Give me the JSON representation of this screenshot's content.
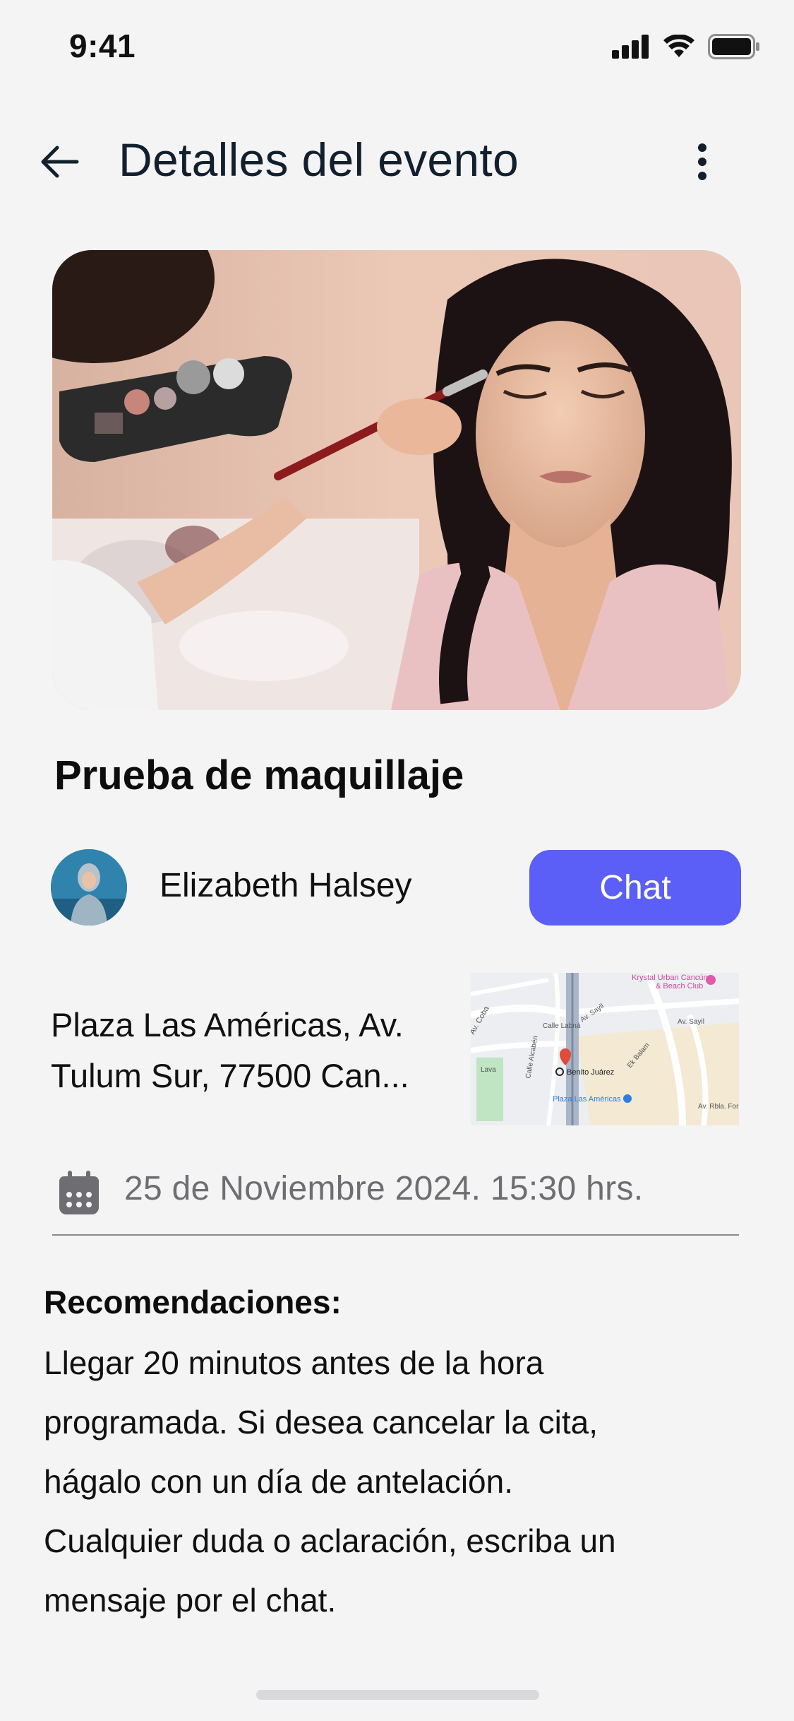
{
  "status": {
    "time": "9:41",
    "icons": [
      "cellular-signal-icon",
      "wifi-icon",
      "battery-icon"
    ]
  },
  "header": {
    "title": "Detalles del evento",
    "back_icon": "arrow-left-icon",
    "menu_icon": "more-vertical-icon"
  },
  "event": {
    "title": "Prueba de maquillaje",
    "organizer": "Elizabeth Halsey",
    "chat_label": "Chat",
    "address_line1": "Plaza Las Américas, Av.",
    "address_line2": "Tulum Sur, 77500 Can...",
    "map": {
      "place_main": "Benito Juárez",
      "place_mall": "Plaza Las Américas",
      "place_hotel": "Krystal Urban Cancún & Beach Club",
      "hotel_line1": "Krystal Urban Cancún",
      "hotel_line2": "& Beach Club",
      "street_1": "Av. Coba",
      "street_2": "Calle Labná",
      "street_3": "Av. Sayil",
      "street_4": "Calle Alcabén",
      "street_5": "Ek Balam",
      "street_6": "Av. Sayil",
      "street_7": "Av. Rbla. For",
      "street_8": "Lava"
    },
    "date": "25 de Noviembre 2024. 15:30 hrs.",
    "calendar_icon": "calendar-icon"
  },
  "recommendations": {
    "title": "Recomendaciones:",
    "lines": [
      "Llegar 20 minutos antes de la hora",
      "programada. Si desea cancelar la cita,",
      "hágalo con un día de antelación.",
      "Cualquier duda o aclaración, escriba un",
      "mensaje por el chat."
    ]
  },
  "colors": {
    "accent": "#5b5ff7",
    "background": "#f4f4f5",
    "title": "#12202e",
    "muted": "#6d6d72"
  }
}
